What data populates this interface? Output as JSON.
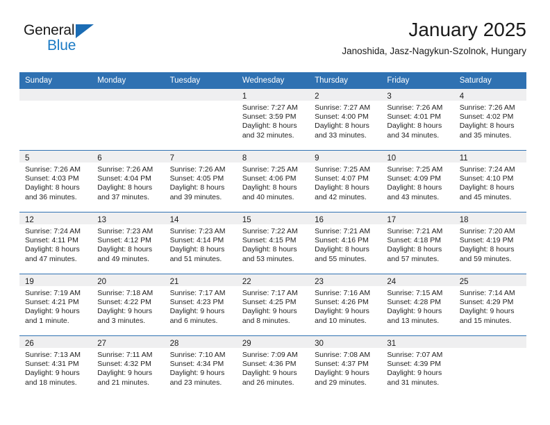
{
  "brand": {
    "word_general": "General",
    "word_blue": "Blue",
    "triangle_color": "#1b6cb4",
    "blue_color": "#1b7ac4"
  },
  "header": {
    "title": "January 2025",
    "subtitle": "Janoshida, Jasz-Nagykun-Szolnok, Hungary"
  },
  "theme": {
    "header_blue": "#2f71b2",
    "daynum_band_gray": "#efeff0",
    "text_dark": "#1a1a1a"
  },
  "weekday_headers": [
    "Sunday",
    "Monday",
    "Tuesday",
    "Wednesday",
    "Thursday",
    "Friday",
    "Saturday"
  ],
  "weeks": [
    [
      {
        "day": "",
        "sunrise": "",
        "sunset": "",
        "daylight_line1": "",
        "daylight_line2": ""
      },
      {
        "day": "",
        "sunrise": "",
        "sunset": "",
        "daylight_line1": "",
        "daylight_line2": ""
      },
      {
        "day": "",
        "sunrise": "",
        "sunset": "",
        "daylight_line1": "",
        "daylight_line2": ""
      },
      {
        "day": "1",
        "sunrise": "Sunrise: 7:27 AM",
        "sunset": "Sunset: 3:59 PM",
        "daylight_line1": "Daylight: 8 hours",
        "daylight_line2": "and 32 minutes."
      },
      {
        "day": "2",
        "sunrise": "Sunrise: 7:27 AM",
        "sunset": "Sunset: 4:00 PM",
        "daylight_line1": "Daylight: 8 hours",
        "daylight_line2": "and 33 minutes."
      },
      {
        "day": "3",
        "sunrise": "Sunrise: 7:26 AM",
        "sunset": "Sunset: 4:01 PM",
        "daylight_line1": "Daylight: 8 hours",
        "daylight_line2": "and 34 minutes."
      },
      {
        "day": "4",
        "sunrise": "Sunrise: 7:26 AM",
        "sunset": "Sunset: 4:02 PM",
        "daylight_line1": "Daylight: 8 hours",
        "daylight_line2": "and 35 minutes."
      }
    ],
    [
      {
        "day": "5",
        "sunrise": "Sunrise: 7:26 AM",
        "sunset": "Sunset: 4:03 PM",
        "daylight_line1": "Daylight: 8 hours",
        "daylight_line2": "and 36 minutes."
      },
      {
        "day": "6",
        "sunrise": "Sunrise: 7:26 AM",
        "sunset": "Sunset: 4:04 PM",
        "daylight_line1": "Daylight: 8 hours",
        "daylight_line2": "and 37 minutes."
      },
      {
        "day": "7",
        "sunrise": "Sunrise: 7:26 AM",
        "sunset": "Sunset: 4:05 PM",
        "daylight_line1": "Daylight: 8 hours",
        "daylight_line2": "and 39 minutes."
      },
      {
        "day": "8",
        "sunrise": "Sunrise: 7:25 AM",
        "sunset": "Sunset: 4:06 PM",
        "daylight_line1": "Daylight: 8 hours",
        "daylight_line2": "and 40 minutes."
      },
      {
        "day": "9",
        "sunrise": "Sunrise: 7:25 AM",
        "sunset": "Sunset: 4:07 PM",
        "daylight_line1": "Daylight: 8 hours",
        "daylight_line2": "and 42 minutes."
      },
      {
        "day": "10",
        "sunrise": "Sunrise: 7:25 AM",
        "sunset": "Sunset: 4:09 PM",
        "daylight_line1": "Daylight: 8 hours",
        "daylight_line2": "and 43 minutes."
      },
      {
        "day": "11",
        "sunrise": "Sunrise: 7:24 AM",
        "sunset": "Sunset: 4:10 PM",
        "daylight_line1": "Daylight: 8 hours",
        "daylight_line2": "and 45 minutes."
      }
    ],
    [
      {
        "day": "12",
        "sunrise": "Sunrise: 7:24 AM",
        "sunset": "Sunset: 4:11 PM",
        "daylight_line1": "Daylight: 8 hours",
        "daylight_line2": "and 47 minutes."
      },
      {
        "day": "13",
        "sunrise": "Sunrise: 7:23 AM",
        "sunset": "Sunset: 4:12 PM",
        "daylight_line1": "Daylight: 8 hours",
        "daylight_line2": "and 49 minutes."
      },
      {
        "day": "14",
        "sunrise": "Sunrise: 7:23 AM",
        "sunset": "Sunset: 4:14 PM",
        "daylight_line1": "Daylight: 8 hours",
        "daylight_line2": "and 51 minutes."
      },
      {
        "day": "15",
        "sunrise": "Sunrise: 7:22 AM",
        "sunset": "Sunset: 4:15 PM",
        "daylight_line1": "Daylight: 8 hours",
        "daylight_line2": "and 53 minutes."
      },
      {
        "day": "16",
        "sunrise": "Sunrise: 7:21 AM",
        "sunset": "Sunset: 4:16 PM",
        "daylight_line1": "Daylight: 8 hours",
        "daylight_line2": "and 55 minutes."
      },
      {
        "day": "17",
        "sunrise": "Sunrise: 7:21 AM",
        "sunset": "Sunset: 4:18 PM",
        "daylight_line1": "Daylight: 8 hours",
        "daylight_line2": "and 57 minutes."
      },
      {
        "day": "18",
        "sunrise": "Sunrise: 7:20 AM",
        "sunset": "Sunset: 4:19 PM",
        "daylight_line1": "Daylight: 8 hours",
        "daylight_line2": "and 59 minutes."
      }
    ],
    [
      {
        "day": "19",
        "sunrise": "Sunrise: 7:19 AM",
        "sunset": "Sunset: 4:21 PM",
        "daylight_line1": "Daylight: 9 hours",
        "daylight_line2": "and 1 minute."
      },
      {
        "day": "20",
        "sunrise": "Sunrise: 7:18 AM",
        "sunset": "Sunset: 4:22 PM",
        "daylight_line1": "Daylight: 9 hours",
        "daylight_line2": "and 3 minutes."
      },
      {
        "day": "21",
        "sunrise": "Sunrise: 7:17 AM",
        "sunset": "Sunset: 4:23 PM",
        "daylight_line1": "Daylight: 9 hours",
        "daylight_line2": "and 6 minutes."
      },
      {
        "day": "22",
        "sunrise": "Sunrise: 7:17 AM",
        "sunset": "Sunset: 4:25 PM",
        "daylight_line1": "Daylight: 9 hours",
        "daylight_line2": "and 8 minutes."
      },
      {
        "day": "23",
        "sunrise": "Sunrise: 7:16 AM",
        "sunset": "Sunset: 4:26 PM",
        "daylight_line1": "Daylight: 9 hours",
        "daylight_line2": "and 10 minutes."
      },
      {
        "day": "24",
        "sunrise": "Sunrise: 7:15 AM",
        "sunset": "Sunset: 4:28 PM",
        "daylight_line1": "Daylight: 9 hours",
        "daylight_line2": "and 13 minutes."
      },
      {
        "day": "25",
        "sunrise": "Sunrise: 7:14 AM",
        "sunset": "Sunset: 4:29 PM",
        "daylight_line1": "Daylight: 9 hours",
        "daylight_line2": "and 15 minutes."
      }
    ],
    [
      {
        "day": "26",
        "sunrise": "Sunrise: 7:13 AM",
        "sunset": "Sunset: 4:31 PM",
        "daylight_line1": "Daylight: 9 hours",
        "daylight_line2": "and 18 minutes."
      },
      {
        "day": "27",
        "sunrise": "Sunrise: 7:11 AM",
        "sunset": "Sunset: 4:32 PM",
        "daylight_line1": "Daylight: 9 hours",
        "daylight_line2": "and 21 minutes."
      },
      {
        "day": "28",
        "sunrise": "Sunrise: 7:10 AM",
        "sunset": "Sunset: 4:34 PM",
        "daylight_line1": "Daylight: 9 hours",
        "daylight_line2": "and 23 minutes."
      },
      {
        "day": "29",
        "sunrise": "Sunrise: 7:09 AM",
        "sunset": "Sunset: 4:36 PM",
        "daylight_line1": "Daylight: 9 hours",
        "daylight_line2": "and 26 minutes."
      },
      {
        "day": "30",
        "sunrise": "Sunrise: 7:08 AM",
        "sunset": "Sunset: 4:37 PM",
        "daylight_line1": "Daylight: 9 hours",
        "daylight_line2": "and 29 minutes."
      },
      {
        "day": "31",
        "sunrise": "Sunrise: 7:07 AM",
        "sunset": "Sunset: 4:39 PM",
        "daylight_line1": "Daylight: 9 hours",
        "daylight_line2": "and 31 minutes."
      },
      {
        "day": "",
        "sunrise": "",
        "sunset": "",
        "daylight_line1": "",
        "daylight_line2": ""
      }
    ]
  ]
}
